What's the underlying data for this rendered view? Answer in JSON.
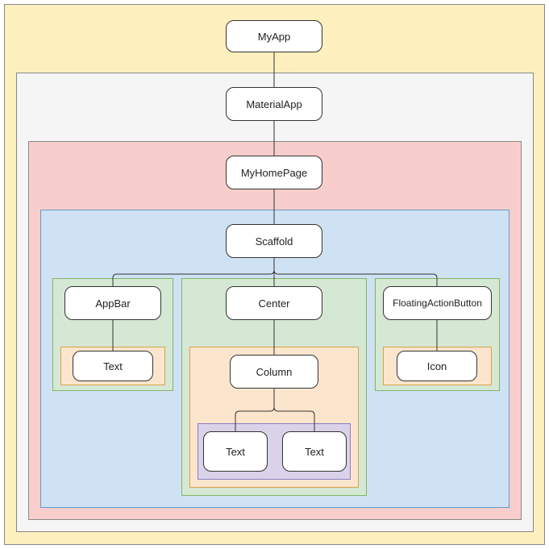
{
  "diagram": {
    "type": "widget-tree",
    "nodes": {
      "root": "MyApp",
      "l1": "MaterialApp",
      "l2": "MyHomePage",
      "l3": "Scaffold",
      "appbar": "AppBar",
      "appbar_text": "Text",
      "center": "Center",
      "column": "Column",
      "col_text1": "Text",
      "col_text2": "Text",
      "fab": "FloatingActionButton",
      "fab_icon": "Icon"
    },
    "containers": {
      "outer": "#FEF0BE",
      "gray": "#F5F5F5",
      "pink": "#F8CECC",
      "blue": "#CFE2F3",
      "green1": "#D5E8D4",
      "green2": "#D5E8D4",
      "green3": "#D5E8D4",
      "orange1": "#FCE5CD",
      "orange2": "#FCE5CD",
      "orange3": "#FCE5CD",
      "purple": "#D9D2E9"
    }
  }
}
